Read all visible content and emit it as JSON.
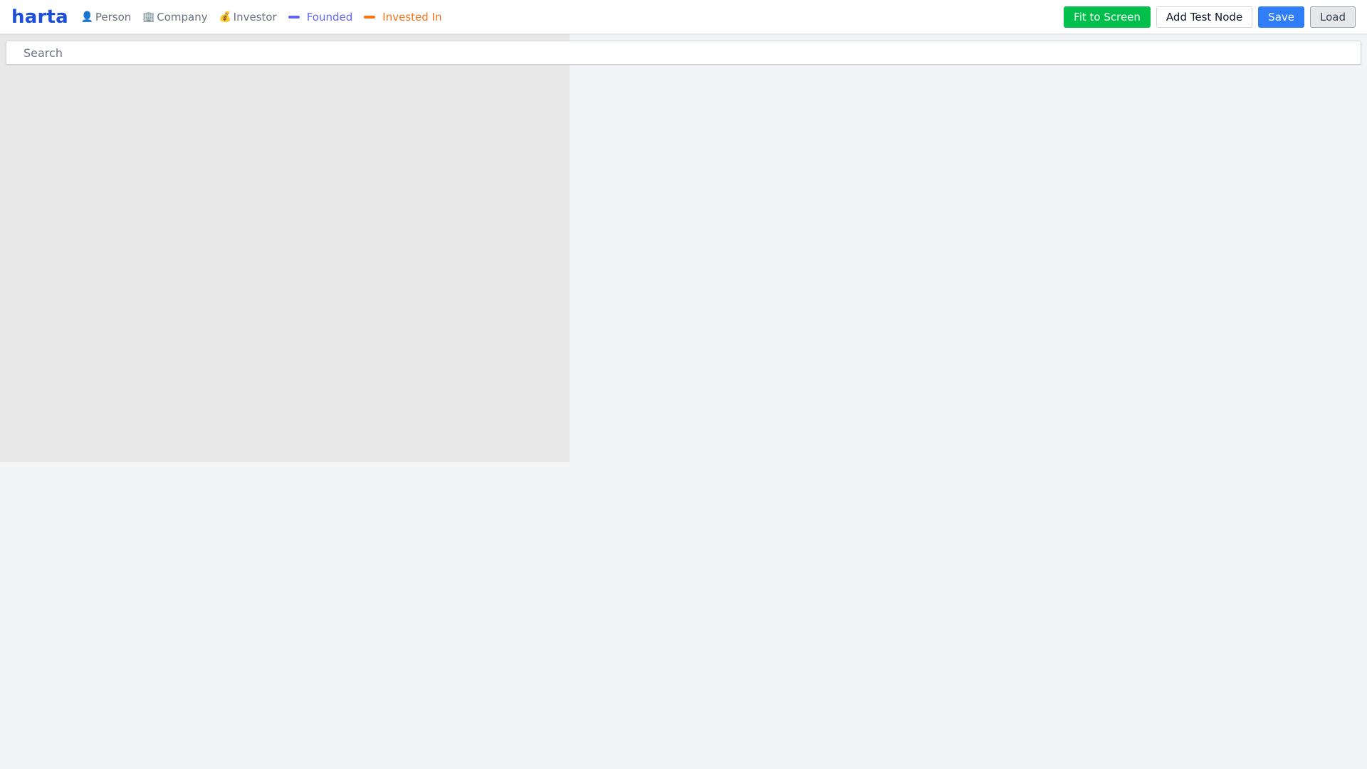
{
  "app": {
    "brand": "harta"
  },
  "legend": {
    "nodes": [
      {
        "label": "Person",
        "icon": "person-icon",
        "glyph": "👤"
      },
      {
        "label": "Company",
        "icon": "office-building-icon",
        "glyph": "🏢"
      },
      {
        "label": "Investor",
        "icon": "money-bag-icon",
        "glyph": "💰"
      }
    ],
    "edges": [
      {
        "label": "Founded",
        "color": "#6366f1"
      },
      {
        "label": "Invested In",
        "color": "#f97316"
      }
    ]
  },
  "toolbar": {
    "fit_label": "Fit to Screen",
    "add_label": "Add Test Node",
    "save_label": "Save",
    "load_label": "Load",
    "colors": {
      "fit": "#00c04b",
      "save": "#2f7ef7",
      "load": "#e5e7eb"
    }
  },
  "search": {
    "placeholder": "Search",
    "value": ""
  }
}
